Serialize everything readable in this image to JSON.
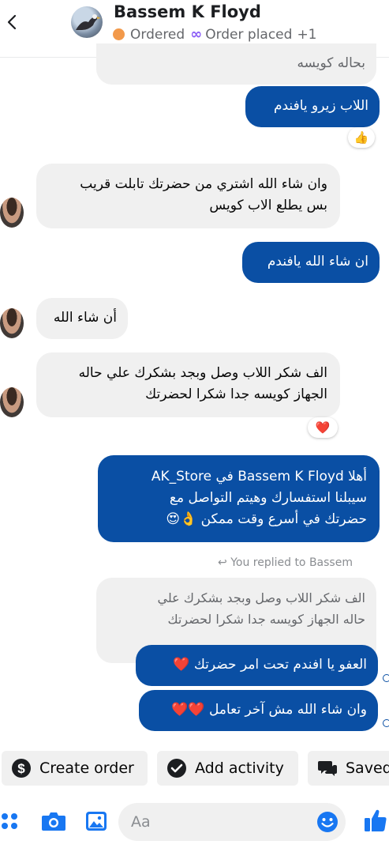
{
  "header": {
    "name": "Bassem K Floyd",
    "status_ordered": "Ordered",
    "status_placed": "Order placed",
    "status_more": "+1",
    "colors": {
      "ordered_dot": "#f2994a",
      "infinity": "#8a5cf6"
    }
  },
  "messages": {
    "m0": "بحاله كويسه",
    "m1": "اللاب زيرو يافندم",
    "m1_reaction": "👍",
    "m2_l1": "وان شاء الله اشتري من حضرتك تابلت قريب",
    "m2_l2": "بس يطلع الاب كويس",
    "m3": "ان شاء الله يافندم",
    "m4": "أن شاء الله",
    "m5_l1": "الف شكر اللاب وصل وبجد بشكرك علي حاله",
    "m5_l2": "الجهاز كويسه جدا شكرا لحضرتك",
    "m5_reaction": "❤️",
    "m6_l1": "أهلا Bassem K Floyd في AK_Store",
    "m6_l2": "سيبلنا استفسارك وهيتم التواصل مع",
    "m6_l3": "حضرتك في أسرع وقت ممكن 👌😍",
    "replied_label": "You replied to Bassem",
    "quoted_l1": "الف شكر اللاب وصل وبجد بشكرك علي",
    "quoted_l2": "حاله الجهاز كويسه جدا شكرا لحضرتك",
    "m7": "العفو يا افندم تحت امر حضرتك ❤️",
    "m8": "وان شاء الله مش آخر تعامل ❤️❤️"
  },
  "actions": {
    "create_order": "Create order",
    "add_activity": "Add activity",
    "saved": "Saved"
  },
  "composer": {
    "placeholder": "Aa"
  },
  "theme": {
    "outgoing_bubble": "#0a4fa4",
    "incoming_bubble": "#f0f0f0",
    "accent": "#1877f2"
  }
}
